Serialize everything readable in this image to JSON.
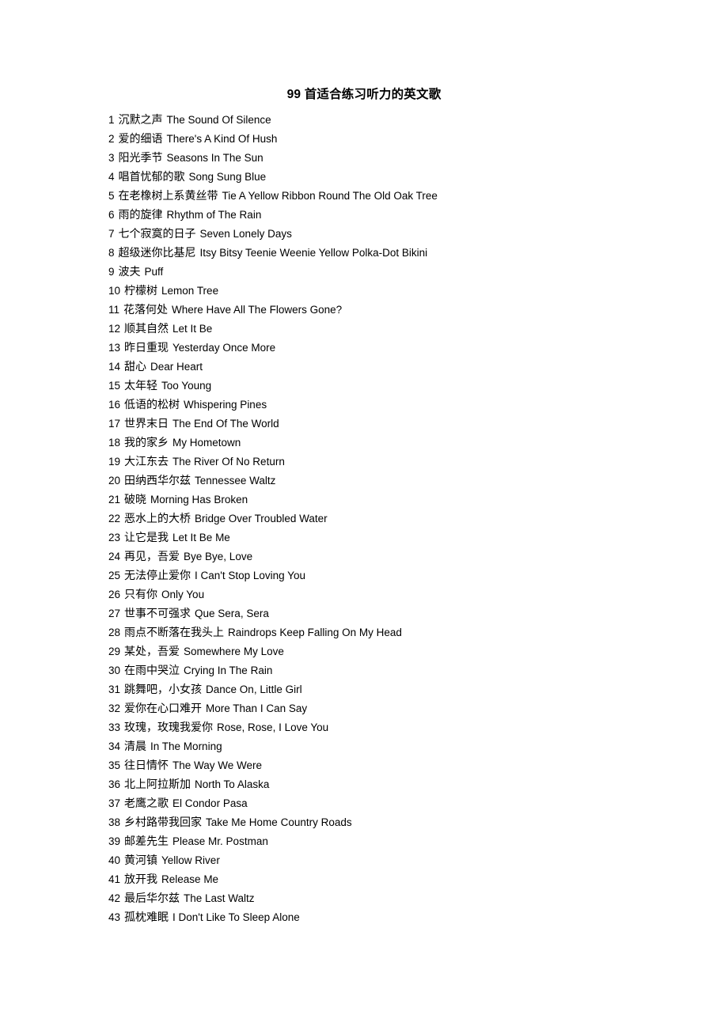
{
  "document": {
    "title": "99 首适合练习听力的英文歌",
    "songs": [
      {
        "index": "1",
        "cn": "沉默之声",
        "en": "The Sound Of Silence"
      },
      {
        "index": "2",
        "cn": "爱的细语",
        "en": "There's A Kind Of Hush"
      },
      {
        "index": "3",
        "cn": "阳光季节",
        "en": "Seasons In The Sun"
      },
      {
        "index": "4",
        "cn": "唱首忧郁的歌",
        "en": "Song Sung Blue"
      },
      {
        "index": "5",
        "cn": "在老橡树上系黄丝带",
        "en": "Tie A Yellow Ribbon Round The Old Oak Tree"
      },
      {
        "index": "6",
        "cn": "雨的旋律",
        "en": "Rhythm of The Rain"
      },
      {
        "index": "7",
        "cn": "七个寂寞的日子",
        "en": "Seven Lonely Days"
      },
      {
        "index": "8",
        "cn": "超级迷你比基尼",
        "en": "Itsy Bitsy Teenie Weenie Yellow Polka-Dot Bikini"
      },
      {
        "index": "9",
        "cn": "波夫",
        "en": "Puff"
      },
      {
        "index": "10",
        "cn": "柠檬树",
        "en": "Lemon Tree"
      },
      {
        "index": "11",
        "cn": "花落何处",
        "en": "Where Have All The Flowers Gone?"
      },
      {
        "index": "12",
        "cn": "顺其自然",
        "en": "Let It Be"
      },
      {
        "index": "13",
        "cn": "昨日重现",
        "en": "Yesterday Once More"
      },
      {
        "index": "14",
        "cn": "甜心",
        "en": "Dear Heart"
      },
      {
        "index": "15",
        "cn": "太年轻",
        "en": "Too Young"
      },
      {
        "index": "16",
        "cn": "低语的松树",
        "en": "Whispering Pines"
      },
      {
        "index": "17",
        "cn": "世界末日",
        "en": "The End Of The World"
      },
      {
        "index": "18",
        "cn": "我的家乡",
        "en": "My Hometown"
      },
      {
        "index": "19",
        "cn": "大江东去",
        "en": "The River Of No Return"
      },
      {
        "index": "20",
        "cn": "田纳西华尔兹",
        "en": "Tennessee Waltz"
      },
      {
        "index": "21",
        "cn": "破晓",
        "en": "Morning Has Broken"
      },
      {
        "index": "22",
        "cn": "恶水上的大桥",
        "en": "Bridge Over Troubled Water"
      },
      {
        "index": "23",
        "cn": "让它是我",
        "en": "Let It Be Me"
      },
      {
        "index": "24",
        "cn": "再见，吾爱",
        "en": "Bye Bye, Love"
      },
      {
        "index": "25",
        "cn": "无法停止爱你",
        "en": "I Can't Stop Loving You"
      },
      {
        "index": "26",
        "cn": "只有你",
        "en": "Only You"
      },
      {
        "index": "27",
        "cn": "世事不可强求",
        "en": "Que Sera, Sera"
      },
      {
        "index": "28",
        "cn": "雨点不断落在我头上",
        "en": "Raindrops Keep Falling On My Head"
      },
      {
        "index": "29",
        "cn": "某处，吾爱",
        "en": "Somewhere My Love"
      },
      {
        "index": "30",
        "cn": "在雨中哭泣",
        "en": "Crying In The Rain"
      },
      {
        "index": "31",
        "cn": "跳舞吧，小女孩",
        "en": "Dance On, Little Girl"
      },
      {
        "index": "32",
        "cn": "爱你在心口难开",
        "en": "More Than I Can Say"
      },
      {
        "index": "33",
        "cn": "玫瑰，玫瑰我爱你",
        "en": "Rose, Rose, I Love You"
      },
      {
        "index": "34",
        "cn": "清晨",
        "en": "In The Morning"
      },
      {
        "index": "35",
        "cn": "往日情怀",
        "en": "The Way We Were"
      },
      {
        "index": "36",
        "cn": "北上阿拉斯加",
        "en": "North To Alaska"
      },
      {
        "index": "37",
        "cn": "老鹰之歌",
        "en": "El Condor Pasa"
      },
      {
        "index": "38",
        "cn": "乡村路带我回家",
        "en": "Take Me Home Country Roads"
      },
      {
        "index": "39",
        "cn": "邮差先生",
        "en": "Please Mr. Postman"
      },
      {
        "index": "40",
        "cn": "黄河镇",
        "en": "Yellow River"
      },
      {
        "index": "41",
        "cn": "放开我",
        "en": "Release Me"
      },
      {
        "index": "42",
        "cn": "最后华尔兹",
        "en": "The Last Waltz"
      },
      {
        "index": "43",
        "cn": "孤枕难眠",
        "en": "I Don't Like To Sleep Alone"
      }
    ]
  }
}
